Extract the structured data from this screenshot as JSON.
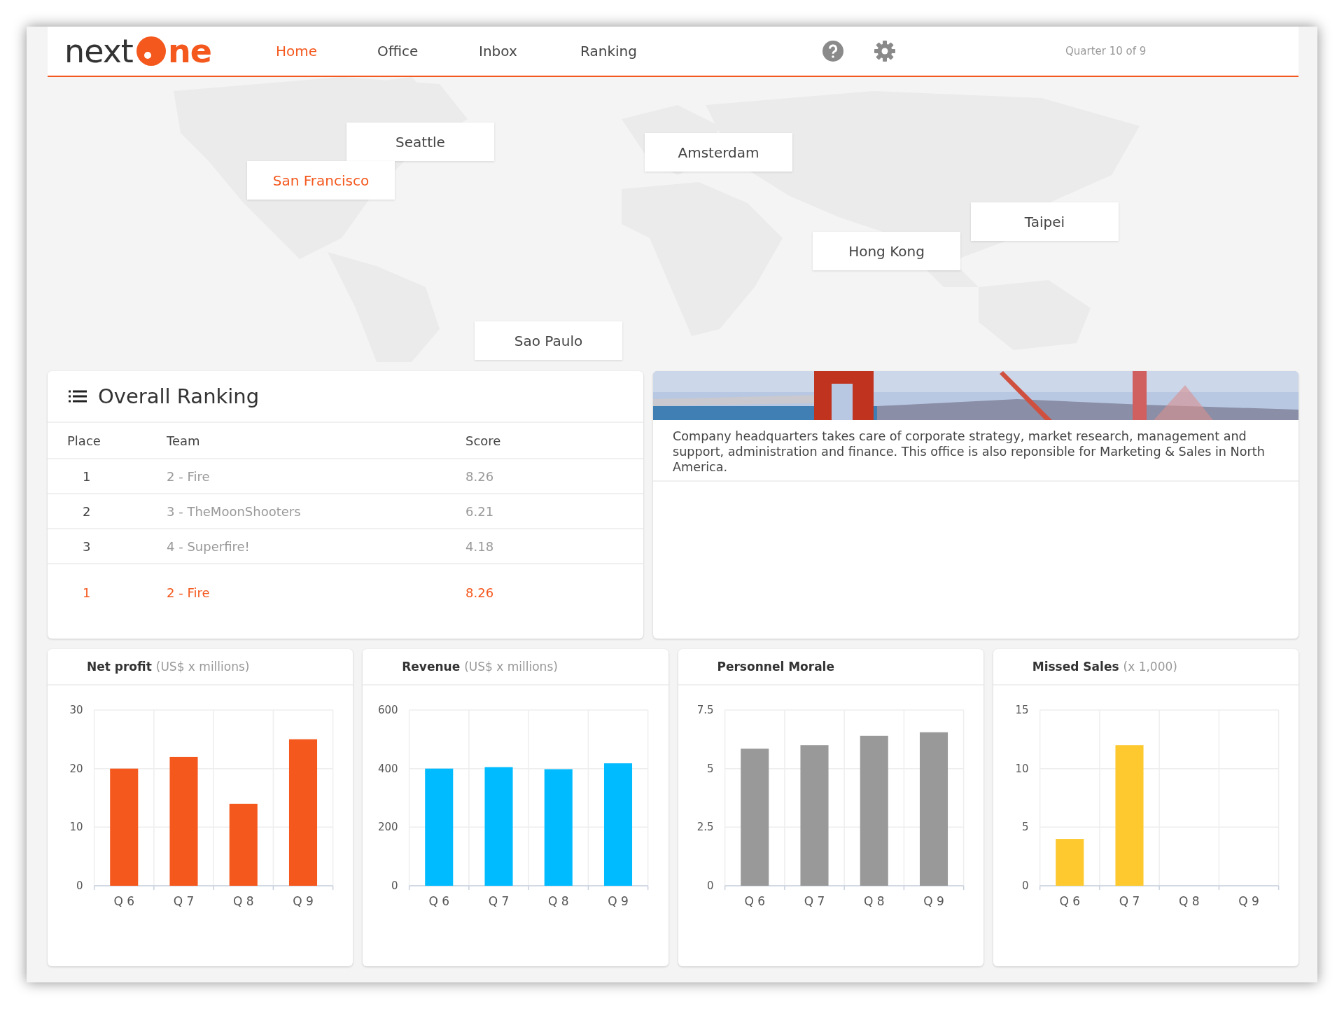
{
  "header": {
    "logo": {
      "prefix": "next",
      "suffix": "ne"
    },
    "nav": [
      {
        "label": "Home",
        "selected": true
      },
      {
        "label": "Office",
        "selected": false
      },
      {
        "label": "Inbox",
        "selected": false
      },
      {
        "label": "Ranking",
        "selected": false
      }
    ],
    "quarter": "Quarter 10 of 9"
  },
  "map": {
    "kind": "picture",
    "cities": [
      {
        "label": "Seattle",
        "selected": false
      },
      {
        "label": "San Francisco",
        "selected": true
      },
      {
        "label": "Amsterdam",
        "selected": false
      },
      {
        "label": "Taipei",
        "selected": false
      },
      {
        "label": "Hong Kong",
        "selected": false
      },
      {
        "label": "Sao Paulo",
        "selected": false
      }
    ]
  },
  "ranking": {
    "title": "Overall Ranking",
    "columns": [
      "Place",
      "Team",
      "Score"
    ],
    "rows": [
      {
        "place": "1",
        "team": "2 - Fire",
        "score": "8.26",
        "highlighted": false
      },
      {
        "place": "2",
        "team": "3 - TheMoonShooters",
        "score": "6.21",
        "highlighted": false
      },
      {
        "place": "3",
        "team": "4 - Superfire!",
        "score": "4.18",
        "highlighted": false
      },
      {
        "place": "1",
        "team": "2 - Fire",
        "score": "8.26",
        "highlighted": true
      }
    ]
  },
  "office": {
    "kind": "picture",
    "description": "Company headquarters takes care of corporate strategy, market research, management and support, administration and finance. This office is also reponsible for Marketing & Sales in North America."
  },
  "charts": [
    {
      "unit": "(US$ x millions)",
      "chart_data": {
        "type": "bar",
        "title": "Net profit",
        "categories": [
          "Q 6",
          "Q 7",
          "Q 8",
          "Q 9"
        ],
        "ylim": [
          0,
          30
        ],
        "yticks": [
          0,
          10,
          20,
          30
        ],
        "series": [
          {
            "color": "#f4581d",
            "values": [
              20,
              22,
              14,
              25
            ]
          }
        ]
      }
    },
    {
      "unit": "(US$ x millions)",
      "chart_data": {
        "type": "bar",
        "title": "Revenue",
        "categories": [
          "Q 6",
          "Q 7",
          "Q 8",
          "Q 9"
        ],
        "ylim": [
          0,
          600
        ],
        "yticks": [
          0,
          200,
          400,
          600
        ],
        "series": [
          {
            "color": "#00bbff",
            "values": [
              400,
              405,
              398,
              418
            ]
          }
        ]
      }
    },
    {
      "chart_data": {
        "type": "bar",
        "title": "Personnel Morale",
        "categories": [
          "Q 6",
          "Q 7",
          "Q 8",
          "Q 9"
        ],
        "ylim": [
          0,
          7.5
        ],
        "yticks": [
          0,
          2.5,
          5,
          7.5
        ],
        "series": [
          {
            "color": "#999999",
            "values": [
              5.85,
              6.0,
              6.4,
              6.55
            ]
          }
        ]
      }
    },
    {
      "unit": "(x 1,000)",
      "chart_data": {
        "type": "bar",
        "title": "Missed Sales",
        "categories": [
          "Q 6",
          "Q 7",
          "Q 8",
          "Q 9"
        ],
        "ylim": [
          0,
          15
        ],
        "yticks": [
          0,
          5,
          10,
          15
        ],
        "series": [
          {
            "color": "#fdc92f",
            "values": [
              4,
              12,
              0,
              0
            ]
          }
        ]
      }
    }
  ]
}
